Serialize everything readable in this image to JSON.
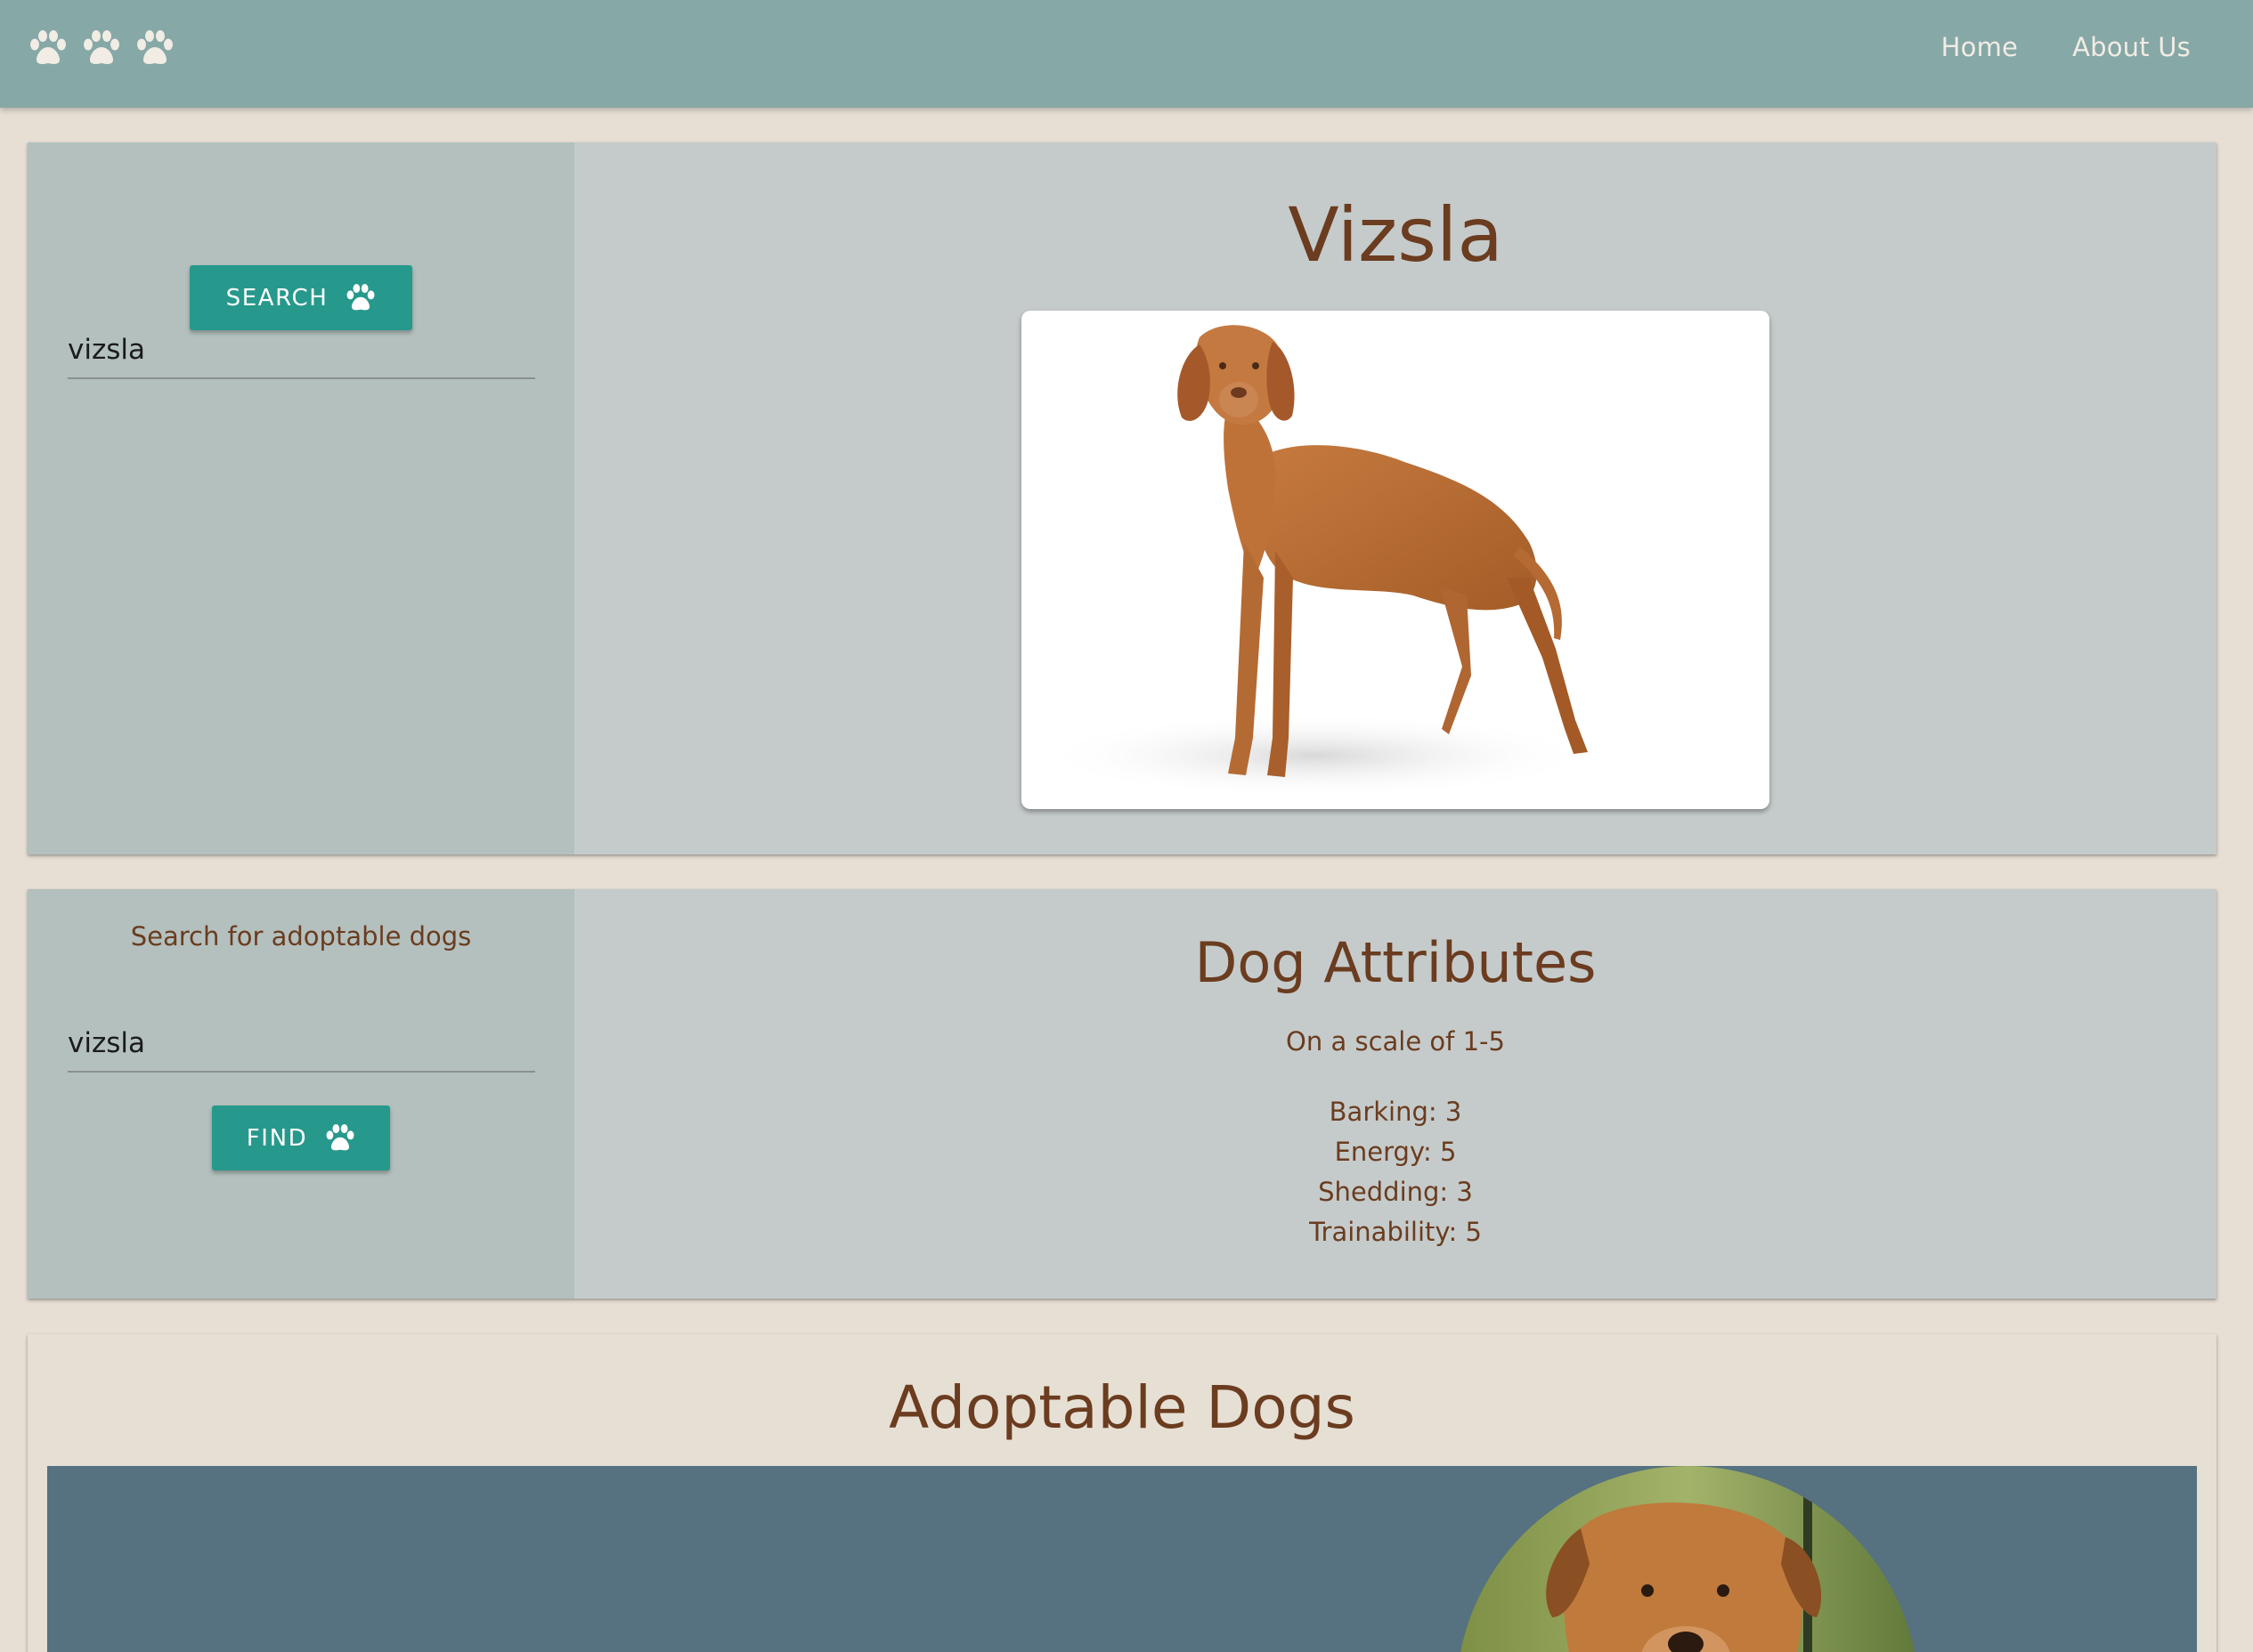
{
  "nav": {
    "logo_icons": [
      "paw-icon",
      "paw-icon",
      "paw-icon"
    ],
    "links": [
      {
        "label": "Home"
      },
      {
        "label": "About Us"
      }
    ]
  },
  "breed_search": {
    "input_value": "vizsla",
    "button_label": "SEARCH",
    "button_icon": "paw-icon"
  },
  "breed": {
    "name": "Vizsla",
    "image": "vizsla-standing-photo"
  },
  "adopt_search": {
    "heading": "Search for adoptable dogs",
    "input_value": "vizsla",
    "button_label": "FIND",
    "button_icon": "paw-icon"
  },
  "attributes": {
    "title": "Dog Attributes",
    "subtitle": "On a scale of 1-5",
    "items": [
      {
        "label": "Barking: 3"
      },
      {
        "label": "Energy: 5"
      },
      {
        "label": "Shedding: 3"
      },
      {
        "label": "Trainability: 5"
      }
    ]
  },
  "adoptable": {
    "title": "Adoptable Dogs",
    "first_photo": "adoptable-dog-photo"
  },
  "colors": {
    "topbar": "#86a8a6",
    "page_bg": "#e7dfd4",
    "card_bg": "#c5cbcb",
    "side_bg": "#b3c0be",
    "accent_button": "#26998c",
    "heading_text": "#6b3c1f",
    "carousel_bg": "#56717f"
  }
}
